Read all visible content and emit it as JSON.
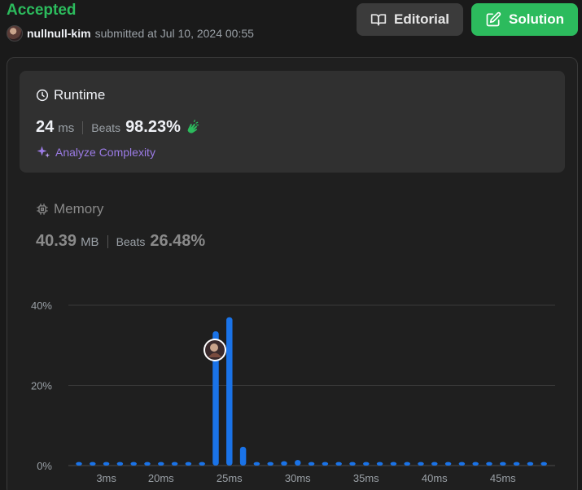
{
  "header": {
    "status": "Accepted",
    "username": "nullnull-kim",
    "submitted_text": "submitted at Jul 10, 2024 00:55",
    "editorial_label": "Editorial",
    "solution_label": "Solution"
  },
  "runtime": {
    "title": "Runtime",
    "value": "24",
    "unit": "ms",
    "beats_label": "Beats",
    "beats_value": "98.23%",
    "analyze_label": "Analyze Complexity"
  },
  "memory": {
    "title": "Memory",
    "value": "40.39",
    "unit": "MB",
    "beats_label": "Beats",
    "beats_value": "26.48%"
  },
  "colors": {
    "accepted": "#2cbb5d",
    "bar": "#1a73e8",
    "analyze": "#9b7be5"
  },
  "chart_data": {
    "type": "bar",
    "y_ticks": [
      "40%",
      "20%",
      "0%"
    ],
    "ylim": [
      0,
      40
    ],
    "x_tick_labels": [
      "3ms",
      "20ms",
      "25ms",
      "30ms",
      "35ms",
      "40ms",
      "45ms"
    ],
    "x_tick_positions": [
      2,
      6,
      11,
      16,
      21,
      26,
      31
    ],
    "bar_count": 35,
    "values": [
      0.9,
      0.9,
      0.9,
      0.9,
      0.9,
      0.9,
      0.9,
      0.9,
      0.9,
      0.9,
      33.5,
      37.0,
      4.7,
      0.9,
      0.9,
      1.1,
      1.4,
      0.9,
      0.9,
      0.9,
      0.9,
      0.9,
      0.9,
      0.9,
      0.9,
      0.9,
      0.9,
      0.9,
      0.9,
      0.9,
      0.9,
      0.9,
      0.9,
      0.9,
      0.9
    ],
    "marker_index": 10
  }
}
